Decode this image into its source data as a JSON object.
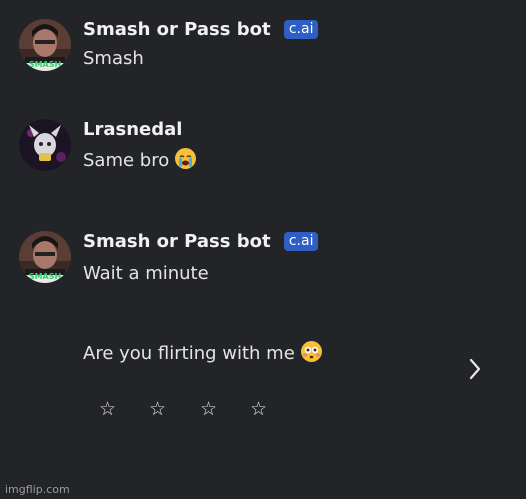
{
  "messages": [
    {
      "author": "Smash or Pass bot",
      "badge": "c.ai",
      "lines": [
        "Smash"
      ],
      "avatar": "character-avatar",
      "avatar_caption": "SMASH"
    },
    {
      "author": "Lrasnedal",
      "lines": [
        "Same bro"
      ],
      "emoji": "loudly-crying-face-emoji",
      "avatar": "user-avatar"
    },
    {
      "author": "Smash or Pass bot",
      "badge": "c.ai",
      "lines": [
        "Wait a minute",
        "Are you flirting with me"
      ],
      "emoji": "flushed-face-emoji",
      "avatar": "character-avatar",
      "avatar_caption": "SMASH"
    }
  ],
  "rating": {
    "stars": [
      "☆",
      "☆",
      "☆",
      "☆"
    ]
  },
  "navigation": {
    "next_icon": "chevron-right-icon"
  },
  "watermark": "imgflip.com",
  "colors": {
    "background": "#232427",
    "badge": "#2f5fc4",
    "avatar_caption": "#2bd46a"
  }
}
